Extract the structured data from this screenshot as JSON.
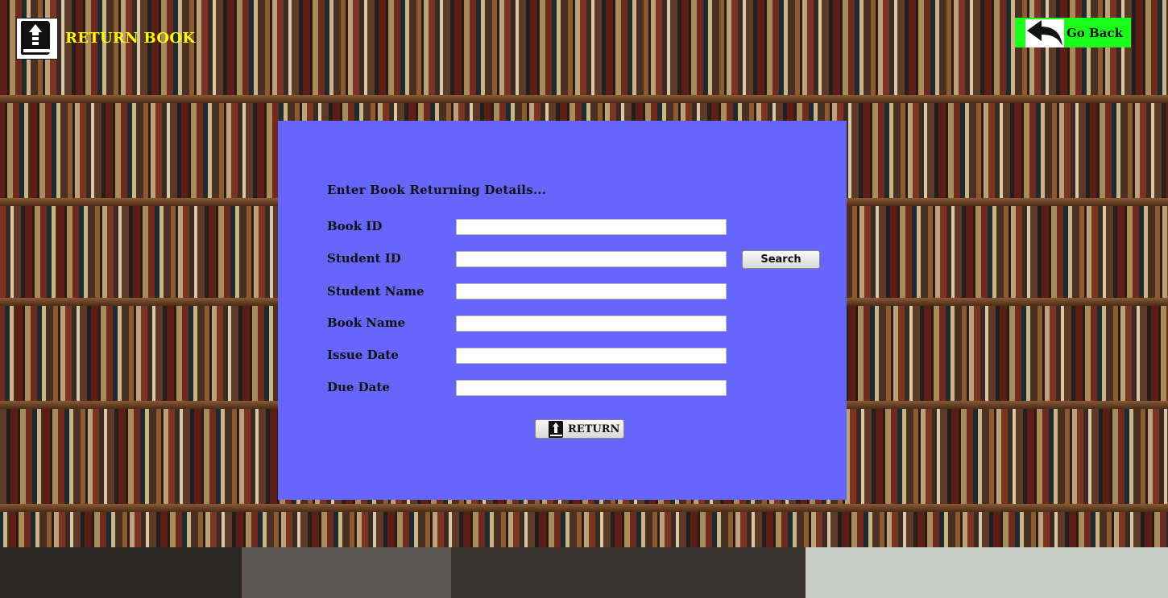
{
  "header": {
    "title": "RETURN BOOK",
    "icon": "return-book-icon",
    "go_back_label": "Go Back",
    "go_back_icon": "back-arrow-icon",
    "go_back_color": "#19ff19",
    "title_color": "#ffff00"
  },
  "panel": {
    "background": "#6666ff",
    "heading": "Enter Book Returning Details...",
    "fields": [
      {
        "label": "Book ID",
        "value": ""
      },
      {
        "label": "Student ID",
        "value": ""
      },
      {
        "label": "Student Name",
        "value": ""
      },
      {
        "label": "Book Name",
        "value": ""
      },
      {
        "label": "Issue Date",
        "value": ""
      },
      {
        "label": "Due Date",
        "value": ""
      }
    ],
    "search_label": "Search",
    "return_label": "RETURN",
    "return_icon": "return-book-icon"
  }
}
